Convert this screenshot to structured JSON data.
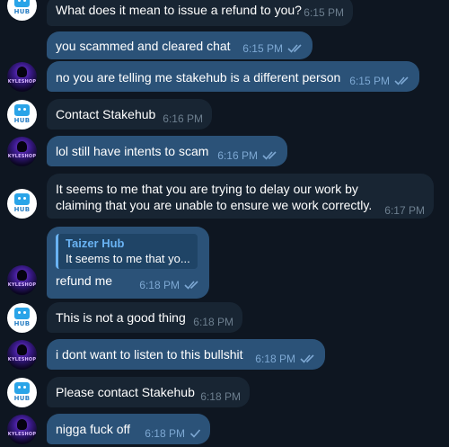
{
  "messages": [
    {
      "text": "What does it mean to issue a refund to you?",
      "time": "6:15 PM"
    },
    {
      "text": "you scammed and cleared chat",
      "time": "6:15 PM"
    },
    {
      "text": "no you are telling me stakehub is a different person",
      "time": "6:15 PM"
    },
    {
      "text": "Contact Stakehub",
      "time": "6:16 PM"
    },
    {
      "text": "lol still have intents to scam",
      "time": "6:16 PM"
    },
    {
      "text": "It seems to me that you are trying to delay our work by claiming that you are unable to ensure we work correctly.",
      "time": "6:17 PM"
    },
    {
      "text": "refund me",
      "time": "6:18 PM",
      "reply": {
        "name": "Taizer Hub",
        "text": "It seems to me that yo..."
      }
    },
    {
      "text": "This is not a good thing",
      "time": "6:18 PM"
    },
    {
      "text": "i dont want to listen to this bullshit",
      "time": "6:18 PM"
    },
    {
      "text": "Please contact Stakehub",
      "time": "6:18 PM"
    },
    {
      "text": "nigga fuck off",
      "time": "6:18 PM"
    }
  ],
  "avatars": {
    "hub": {
      "label": "HUB",
      "icon": "hub-logo-icon"
    },
    "kyle": {
      "label": "KYLESHOP",
      "icon": "kyle-avatar-icon"
    }
  },
  "colors": {
    "background": "#0e1621",
    "incoming_bubble": "#182533",
    "outgoing_bubble": "#2b5278",
    "accent": "#6ab3f3"
  }
}
